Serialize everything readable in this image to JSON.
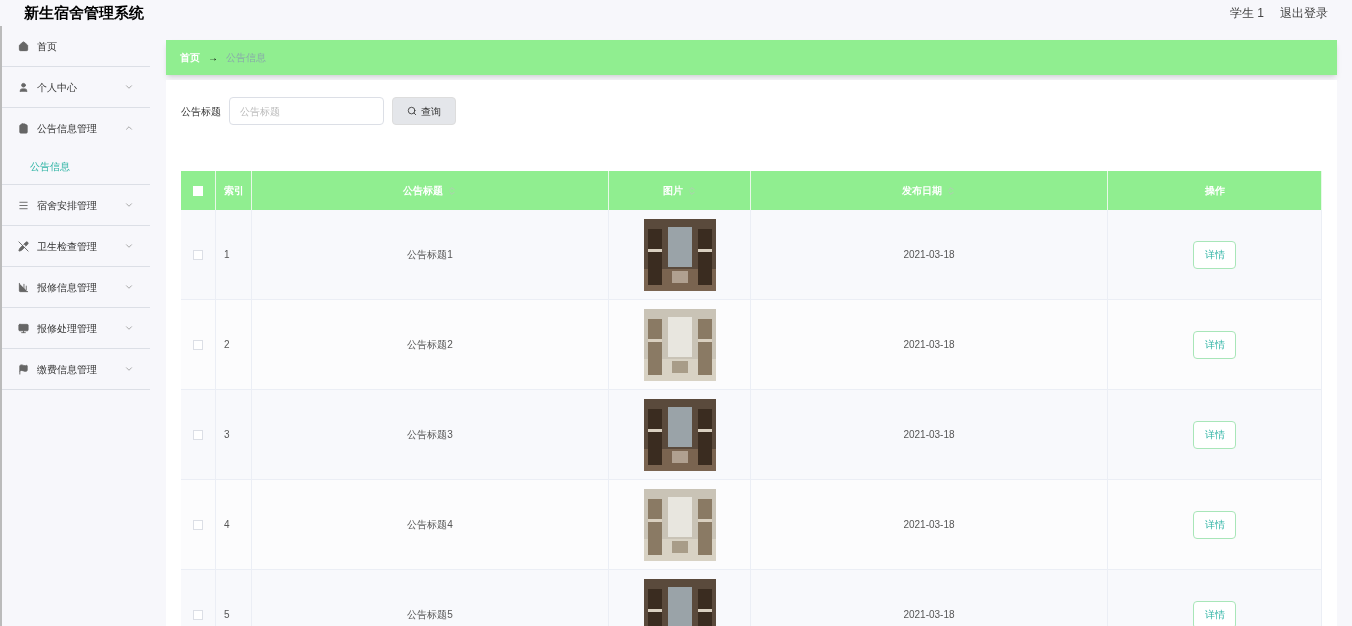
{
  "header": {
    "title": "新生宿舍管理系统",
    "user": "学生 1",
    "logout": "退出登录"
  },
  "menu": [
    {
      "label": "首页",
      "kind": "link"
    },
    {
      "label": "个人中心",
      "kind": "submenu",
      "expanded": false
    },
    {
      "label": "公告信息管理",
      "kind": "submenu",
      "expanded": true,
      "children": [
        {
          "label": "公告信息",
          "selected": true
        }
      ]
    },
    {
      "label": "宿舍安排管理",
      "kind": "submenu",
      "expanded": false
    },
    {
      "label": "卫生检查管理",
      "kind": "submenu",
      "expanded": false
    },
    {
      "label": "报修信息管理",
      "kind": "submenu",
      "expanded": false
    },
    {
      "label": "报修处理管理",
      "kind": "submenu",
      "expanded": false
    },
    {
      "label": "缴费信息管理",
      "kind": "submenu",
      "expanded": false
    }
  ],
  "breadcrumb": {
    "home": "首页",
    "arrow": "→",
    "current": "公告信息"
  },
  "search": {
    "label": "公告标题",
    "placeholder": "公告标题",
    "button": "查询"
  },
  "table": {
    "select_all": {
      "checked": false
    },
    "columns": [
      {
        "label": "索引",
        "sortable": false
      },
      {
        "label": "公告标题",
        "sortable": true
      },
      {
        "label": "图片",
        "sortable": true
      },
      {
        "label": "发布日期",
        "sortable": true
      },
      {
        "label": "操作",
        "sortable": false
      }
    ],
    "rows": [
      {
        "checked": false,
        "index": "1",
        "title": "公告标题1",
        "date": "2021-03-18",
        "action": "详情"
      },
      {
        "checked": false,
        "index": "2",
        "title": "公告标题2",
        "date": "2021-03-18",
        "action": "详情"
      },
      {
        "checked": false,
        "index": "3",
        "title": "公告标题3",
        "date": "2021-03-18",
        "action": "详情"
      },
      {
        "checked": false,
        "index": "4",
        "title": "公告标题4",
        "date": "2021-03-18",
        "action": "详情"
      },
      {
        "checked": false,
        "index": "5",
        "title": "公告标题5",
        "date": "2021-03-18",
        "action": "详情"
      }
    ]
  }
}
